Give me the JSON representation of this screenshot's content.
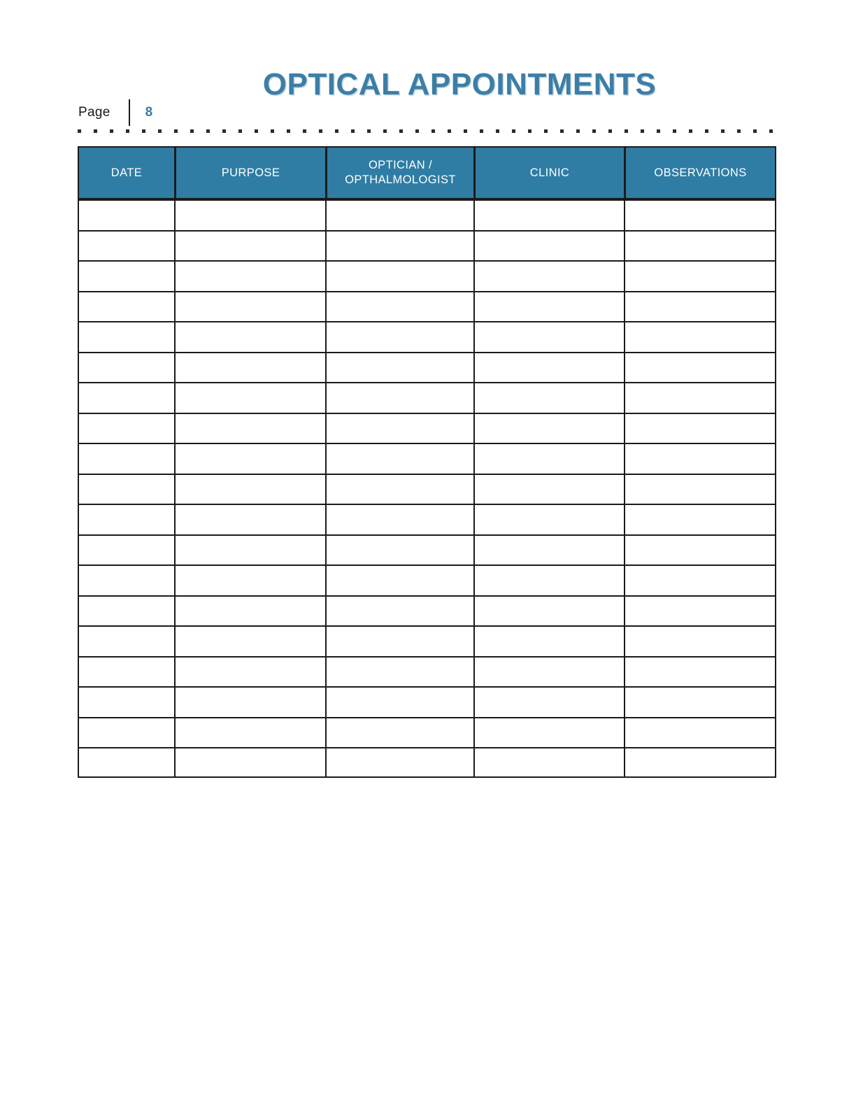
{
  "document": {
    "title": "OPTICAL APPOINTMENTS",
    "page_label": "Page",
    "page_number": "8",
    "accent_color": "#3c7ea6",
    "header_fill_color": "#2f7da4",
    "border_color": "#1b1b1b",
    "background_color": "#ffffff",
    "divider_style": "dotted-rule"
  },
  "table": {
    "columns": [
      {
        "id": "date",
        "label": "DATE"
      },
      {
        "id": "purpose",
        "label": "PURPOSE"
      },
      {
        "id": "optician",
        "label": "OPTICIAN / OPTHALMOLOGIST",
        "line1": "OPTICIAN /",
        "line2": "OPTHALMOLOGIST"
      },
      {
        "id": "clinic",
        "label": "CLINIC"
      },
      {
        "id": "observations",
        "label": "OBSERVATIONS"
      }
    ],
    "row_count": 19,
    "rows": [
      {
        "date": "",
        "purpose": "",
        "optician": "",
        "clinic": "",
        "observations": ""
      },
      {
        "date": "",
        "purpose": "",
        "optician": "",
        "clinic": "",
        "observations": ""
      },
      {
        "date": "",
        "purpose": "",
        "optician": "",
        "clinic": "",
        "observations": ""
      },
      {
        "date": "",
        "purpose": "",
        "optician": "",
        "clinic": "",
        "observations": ""
      },
      {
        "date": "",
        "purpose": "",
        "optician": "",
        "clinic": "",
        "observations": ""
      },
      {
        "date": "",
        "purpose": "",
        "optician": "",
        "clinic": "",
        "observations": ""
      },
      {
        "date": "",
        "purpose": "",
        "optician": "",
        "clinic": "",
        "observations": ""
      },
      {
        "date": "",
        "purpose": "",
        "optician": "",
        "clinic": "",
        "observations": ""
      },
      {
        "date": "",
        "purpose": "",
        "optician": "",
        "clinic": "",
        "observations": ""
      },
      {
        "date": "",
        "purpose": "",
        "optician": "",
        "clinic": "",
        "observations": ""
      },
      {
        "date": "",
        "purpose": "",
        "optician": "",
        "clinic": "",
        "observations": ""
      },
      {
        "date": "",
        "purpose": "",
        "optician": "",
        "clinic": "",
        "observations": ""
      },
      {
        "date": "",
        "purpose": "",
        "optician": "",
        "clinic": "",
        "observations": ""
      },
      {
        "date": "",
        "purpose": "",
        "optician": "",
        "clinic": "",
        "observations": ""
      },
      {
        "date": "",
        "purpose": "",
        "optician": "",
        "clinic": "",
        "observations": ""
      },
      {
        "date": "",
        "purpose": "",
        "optician": "",
        "clinic": "",
        "observations": ""
      },
      {
        "date": "",
        "purpose": "",
        "optician": "",
        "clinic": "",
        "observations": ""
      },
      {
        "date": "",
        "purpose": "",
        "optician": "",
        "clinic": "",
        "observations": ""
      },
      {
        "date": "",
        "purpose": "",
        "optician": "",
        "clinic": "",
        "observations": ""
      }
    ]
  }
}
